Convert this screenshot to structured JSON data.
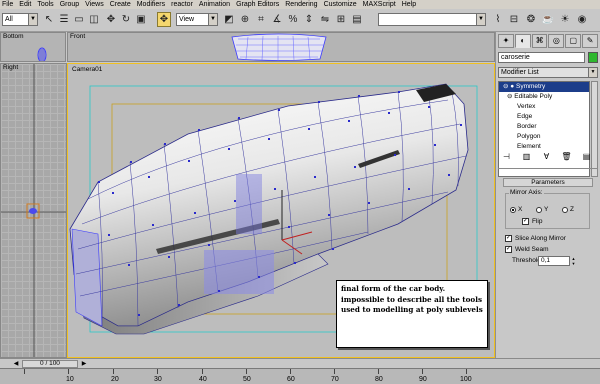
{
  "menu": {
    "items": [
      "File",
      "Edit",
      "Tools",
      "Group",
      "Views",
      "Create",
      "Modifiers",
      "reactor",
      "Animation",
      "Graph Editors",
      "Rendering",
      "Customize",
      "MAXScript",
      "Help"
    ]
  },
  "toolbar": {
    "selection_filter": "All",
    "reference_coord": "View",
    "named_selection": "",
    "icons": [
      "undo-icon",
      "redo-icon",
      "link-icon",
      "unlink-icon",
      "bind-space-warp-icon",
      "select-icon",
      "select-by-name-icon",
      "rect-region-icon",
      "window-crossing-icon",
      "move-icon",
      "rotate-icon",
      "scale-icon",
      "pivot-icon",
      "manipulate-icon",
      "snap-icon",
      "angle-snap-icon",
      "percent-snap-icon",
      "spinner-snap-icon",
      "mirror-icon",
      "align-icon",
      "layer-icon",
      "curve-editor-icon",
      "schematic-icon",
      "material-editor-icon",
      "render-scene-icon",
      "quick-render-icon",
      "render-type-icon",
      "render-last-icon"
    ]
  },
  "viewports": {
    "bottom_label": "Bottom",
    "front_label": "Front",
    "right_label": "Right",
    "camera_label": "Camera01"
  },
  "command_panel": {
    "tabs": [
      "create-tab-icon",
      "modify-tab-icon",
      "hierarchy-tab-icon",
      "motion-tab-icon",
      "display-tab-icon",
      "utilities-tab-icon"
    ],
    "object_name": "caroserie",
    "object_color": "#2fb82f",
    "modifier_list_label": "Modifier List",
    "stack": [
      {
        "label": "Symmetry",
        "selected": true
      },
      {
        "label": "Editable Poly",
        "selected": false
      },
      {
        "label": "Vertex",
        "selected": false
      },
      {
        "label": "Edge",
        "selected": false
      },
      {
        "label": "Border",
        "selected": false
      },
      {
        "label": "Polygon",
        "selected": false
      },
      {
        "label": "Element",
        "selected": false
      }
    ],
    "parameters_title": "Parameters",
    "mirror_axis_title": "Mirror Axis:",
    "axes": [
      {
        "label": "X",
        "checked": true
      },
      {
        "label": "Y",
        "checked": false
      },
      {
        "label": "Z",
        "checked": false
      }
    ],
    "flip_label": "Flip",
    "flip_checked": true,
    "slice_label": "Slice Along Mirror",
    "slice_checked": true,
    "weld_label": "Weld Seam",
    "weld_checked": true,
    "threshold_label": "Threshold",
    "threshold_value": "0,1"
  },
  "timeline": {
    "frame_display": "0 / 100",
    "ticks": [
      "10",
      "20",
      "30",
      "40",
      "50",
      "60",
      "70",
      "80",
      "90",
      "100"
    ]
  },
  "annotation": {
    "text": "final form of the car body. impossible to describe all the tools used to modelling at poly sublevels"
  },
  "colors": {
    "wireframe": "#3a3aff",
    "vertex_ticks": "#2a2acc",
    "safe_frame": "#c8a020",
    "selection": "#1c3d8a"
  }
}
